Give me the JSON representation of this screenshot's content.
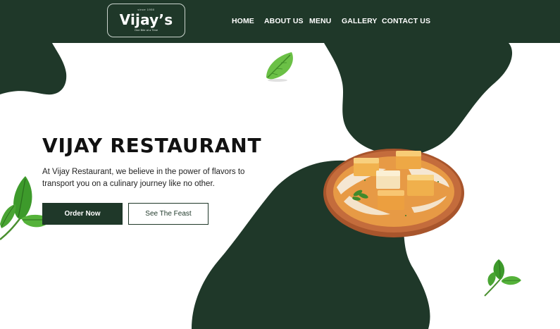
{
  "brand": {
    "tagline_top": "since 1950",
    "name": "Vijay’s",
    "tagline_bottom": "One Bite at a Time"
  },
  "nav": {
    "items": [
      {
        "label": "HOME"
      },
      {
        "label": "ABOUT US"
      },
      {
        "label": "MENU"
      },
      {
        "label": "GALLERY"
      },
      {
        "label": "CONTACT US"
      }
    ]
  },
  "hero": {
    "title": "VIJAY RESTAURANT",
    "description": "At Vijay Restaurant, we believe in the power of flavors to transport you on a culinary journey like no other.",
    "primary_button": "Order Now",
    "secondary_button": "See The Feast"
  },
  "colors": {
    "brand_dark_green": "#1f3829",
    "background": "#ffffff",
    "leaf_green": "#3c9a2c"
  },
  "images": {
    "dish": "paneer-curry-plate",
    "leaves": [
      "basil-leaf",
      "basil-leaf",
      "basil-leaf"
    ]
  }
}
